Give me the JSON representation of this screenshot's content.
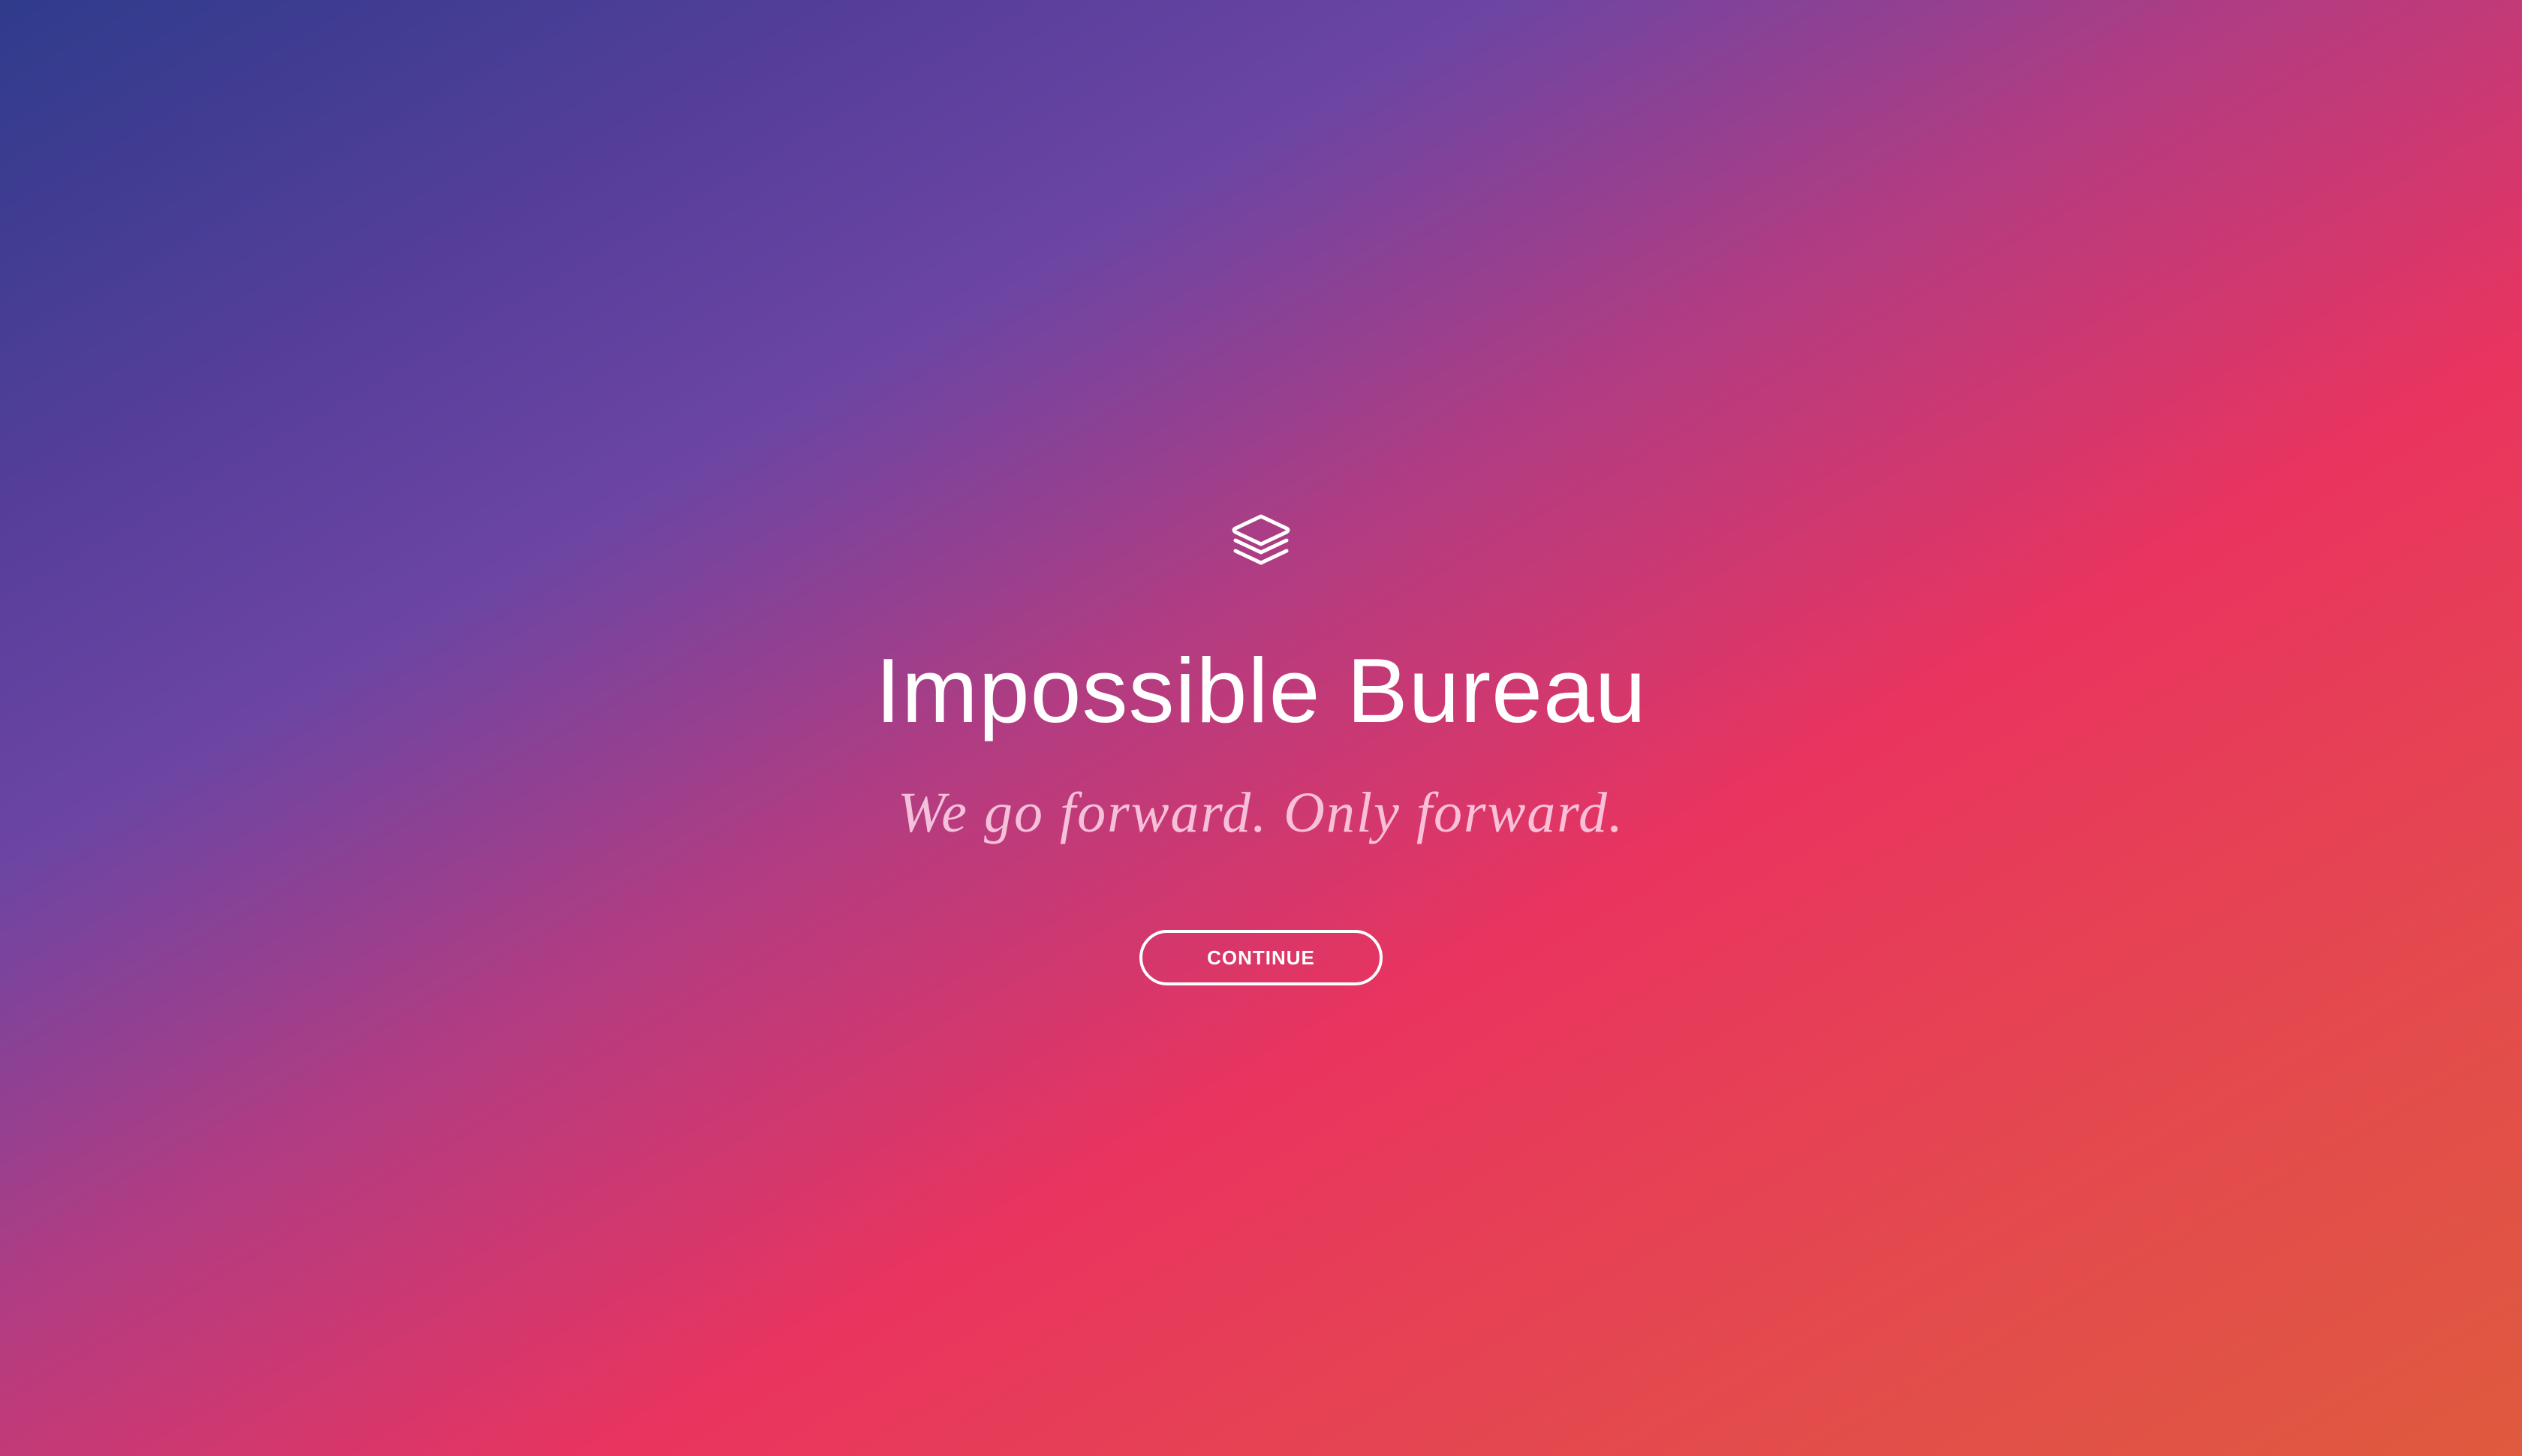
{
  "brand": {
    "logo_icon": "stacked-layers-icon",
    "title": "Impossible Bureau",
    "tagline": "We go forward. Only forward."
  },
  "actions": {
    "continue_label": "CONTINUE"
  },
  "colors": {
    "gradient_start": "#2f3b8c",
    "gradient_mid": "#6d45a3",
    "gradient_accent": "#e9345f",
    "gradient_end": "#df5a3e",
    "text": "#ffffff"
  }
}
